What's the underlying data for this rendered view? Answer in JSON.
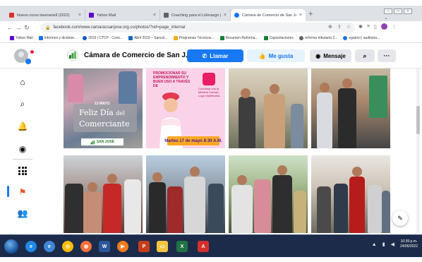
{
  "browser": {
    "tabs": [
      {
        "label": "Nuevo curso lavenanell (2022)",
        "icon": "gmail-icon",
        "color": "#d93025",
        "active": false
      },
      {
        "label": "Yahoo Mail",
        "icon": "yahoo-icon",
        "color": "#6001d2",
        "active": false
      },
      {
        "label": "Coaching para el Liderazgo | Fo",
        "icon": "doc-icon",
        "color": "#5f6368",
        "active": false
      },
      {
        "label": "Cámara de Comercio de San Jos",
        "icon": "facebook-icon",
        "color": "#1877f2",
        "active": true
      }
    ],
    "new_tab": "+",
    "url": "facebook.com/www.camaracsanjose.org.co/photos/?ref=page_internal",
    "bookmarks": [
      {
        "label": "Yahoo Mail",
        "color": "#6001d2"
      },
      {
        "label": "Informes y dictáme...",
        "color": "#1a73e8"
      },
      {
        "label": "2019 | CTCP - Cons...",
        "color": "#0b57d0"
      },
      {
        "label": "Abril 2019 – Sanció...",
        "color": "#1565c0"
      },
      {
        "label": "Programas Técnicos...",
        "color": "#f9ab00"
      },
      {
        "label": "Resumen Reforma...",
        "color": "#188038"
      },
      {
        "label": "Capacitaciones",
        "color": "#188038"
      },
      {
        "label": "reforma tributaria 2...",
        "color": "#5f6368"
      },
      {
        "label": "egatoni | auditoria...",
        "color": "#1a73e8"
      }
    ]
  },
  "page": {
    "name": "Cámara de Comercio de San J...",
    "buttons": {
      "call": "Llamar",
      "like": "Me gusta",
      "message": "Mensaje"
    }
  },
  "photos": {
    "p1": {
      "day_label": "13 MAYO",
      "feliz": "Feliz Día",
      "del": "del",
      "comerciante": "Comerciante",
      "org": "SAN JOSÉ"
    },
    "p2": {
      "promo": "PROMOCIONAR SU EMPRENDIMIENTO Y BUEN USO A TRAVÉS DE",
      "side": "Coordinar con la Ministra Carmen Lugo Valderrama",
      "date": "Martes 17 de mayo  8:30 A.M."
    }
  },
  "taskbar": {
    "time": "10:39 p.m.",
    "date": "24/06/2022"
  }
}
